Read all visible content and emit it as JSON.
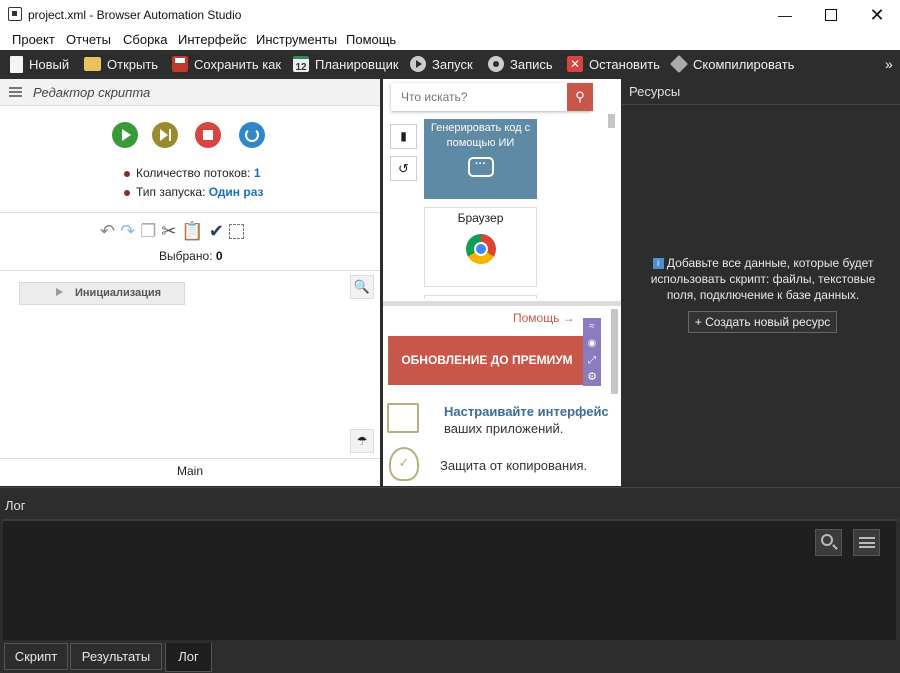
{
  "window": {
    "title": "project.xml - Browser Automation Studio"
  },
  "menu": [
    "Проект",
    "Отчеты",
    "Сборка",
    "Интерфейс",
    "Инструменты",
    "Помощь"
  ],
  "toolbar": {
    "new": "Новый",
    "open": "Открыть",
    "save_as": "Сохранить как",
    "scheduler": "Планировщик",
    "scheduler_icon_num": "12",
    "run": "Запуск",
    "record": "Запись",
    "stop": "Остановить",
    "compile": "Скомпилировать",
    "more": "»"
  },
  "script_editor": {
    "title": "Редактор скрипта",
    "threads_label": "Количество потоков:",
    "threads_value": "1",
    "launch_label": "Тип запуска:",
    "launch_value": "Один раз",
    "selected_label": "Выбрано:",
    "selected_value": "0",
    "init_action": "Инициализация",
    "main_tab": "Main"
  },
  "actions_panel": {
    "search_placeholder": "Что искать?",
    "ai_card": "Генерировать код с помощью ИИ",
    "browser_card": "Браузер"
  },
  "promo": {
    "help": "Помощь →",
    "premium": "ОБНОВЛЕНИЕ ДО ПРЕМИУМ",
    "feature1_a": "Настраивайте интерфейс",
    "feature1_b": "ваших приложений.",
    "feature2": "Защита от копирования."
  },
  "resources": {
    "title": "Ресурсы",
    "info": "Добавьте все данные, которые будет использовать скрипт: файлы, текстовые поля, подключение к базе данных.",
    "create_button": "+ Создать новый ресурс"
  },
  "log": {
    "title": "Лог"
  },
  "bottom_tabs": [
    "Скрипт",
    "Результаты",
    "Лог"
  ],
  "colors": {
    "accent_blue": "#1a6fb5",
    "premium_red": "#c8574a",
    "ai_card": "#5f8aa6",
    "green": "#3a9a3a",
    "stop_red": "#d64541"
  }
}
